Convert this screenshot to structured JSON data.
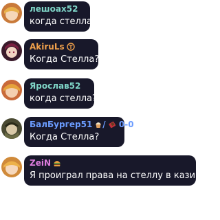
{
  "colors": {
    "bubble_bg": "#18182a",
    "text": "#ffffff"
  },
  "messages": [
    {
      "author": "лешоах52",
      "author_color": "#7fd6c8",
      "text": "когда стелла",
      "badges": []
    },
    {
      "author": "AkiruLs",
      "author_color": "#f0a04b",
      "text": "Когда Стелла?",
      "badges": [
        "award-medal-icon"
      ]
    },
    {
      "author": "Ярослав52",
      "author_color": "#7fd6c8",
      "text": "когда стелла?",
      "badges": []
    },
    {
      "author": "БалБургер51",
      "author_color": "#6b9cff",
      "text": "Когда Стелла?",
      "badges": [
        "cupcake-emoji-icon",
        "chocolate-emoji-icon"
      ],
      "suffix": "/",
      "score": "0-0"
    },
    {
      "author": "ZeiN",
      "author_color": "#e07ee0",
      "text": "Я проиграл права на стеллу в казино",
      "badges": [
        "burger-emoji-icon"
      ]
    }
  ]
}
